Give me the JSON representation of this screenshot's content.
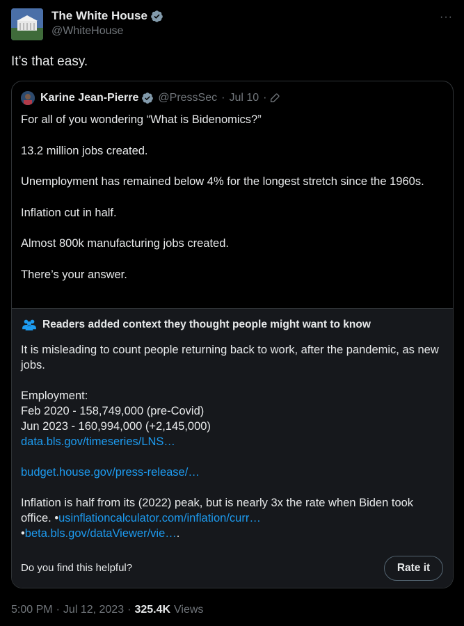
{
  "author": {
    "name": "The White House",
    "handle": "@WhiteHouse",
    "more_label": "···"
  },
  "tweet": {
    "text": "It’s that easy."
  },
  "quote": {
    "name": "Karine Jean-Pierre",
    "handle": "@PressSec",
    "dot": "·",
    "date": "Jul 10",
    "lines": [
      "For all of you wondering “What is Bidenomics?”",
      "13.2 million jobs created.",
      "Unemployment has remained below 4% for the longest stretch since the 1960s.",
      "Inflation cut in half.",
      "Almost 800k manufacturing jobs created.",
      "There’s your answer."
    ]
  },
  "community_note": {
    "title": "Readers added context they thought people might want to know",
    "intro": "It is misleading to count people returning back to work, after the pandemic, as new jobs.",
    "employment_label": "Employment:",
    "employment_lines": [
      "Feb 2020 - 158,749,000 (pre-Covid)",
      "Jun 2023 - 160,994,000 (+2,145,000)"
    ],
    "link1": "data.bls.gov/timeseries/LNS…",
    "link2": "budget.house.gov/press-release/…",
    "inflation_text": "Inflation is half from its (2022) peak, but is nearly 3x the rate when Biden took office.",
    "bullet": "•",
    "link3": "usinflationcalculator.com/inflation/curr…",
    "link4": "beta.bls.gov/dataViewer/vie…",
    "trailing": ".",
    "helpful_prompt": "Do you find this helpful?",
    "rate_label": "Rate it"
  },
  "footer": {
    "time": "5:00 PM",
    "date": "Jul 12, 2023",
    "sep": "·",
    "views_count": "325.4K",
    "views_label": "Views"
  },
  "colors": {
    "background": "#000000",
    "text": "#e7e9ea",
    "muted": "#71767b",
    "link": "#1d9bf0",
    "verified": "#829aab",
    "note_bg": "#16181c",
    "border": "#2f3336"
  }
}
